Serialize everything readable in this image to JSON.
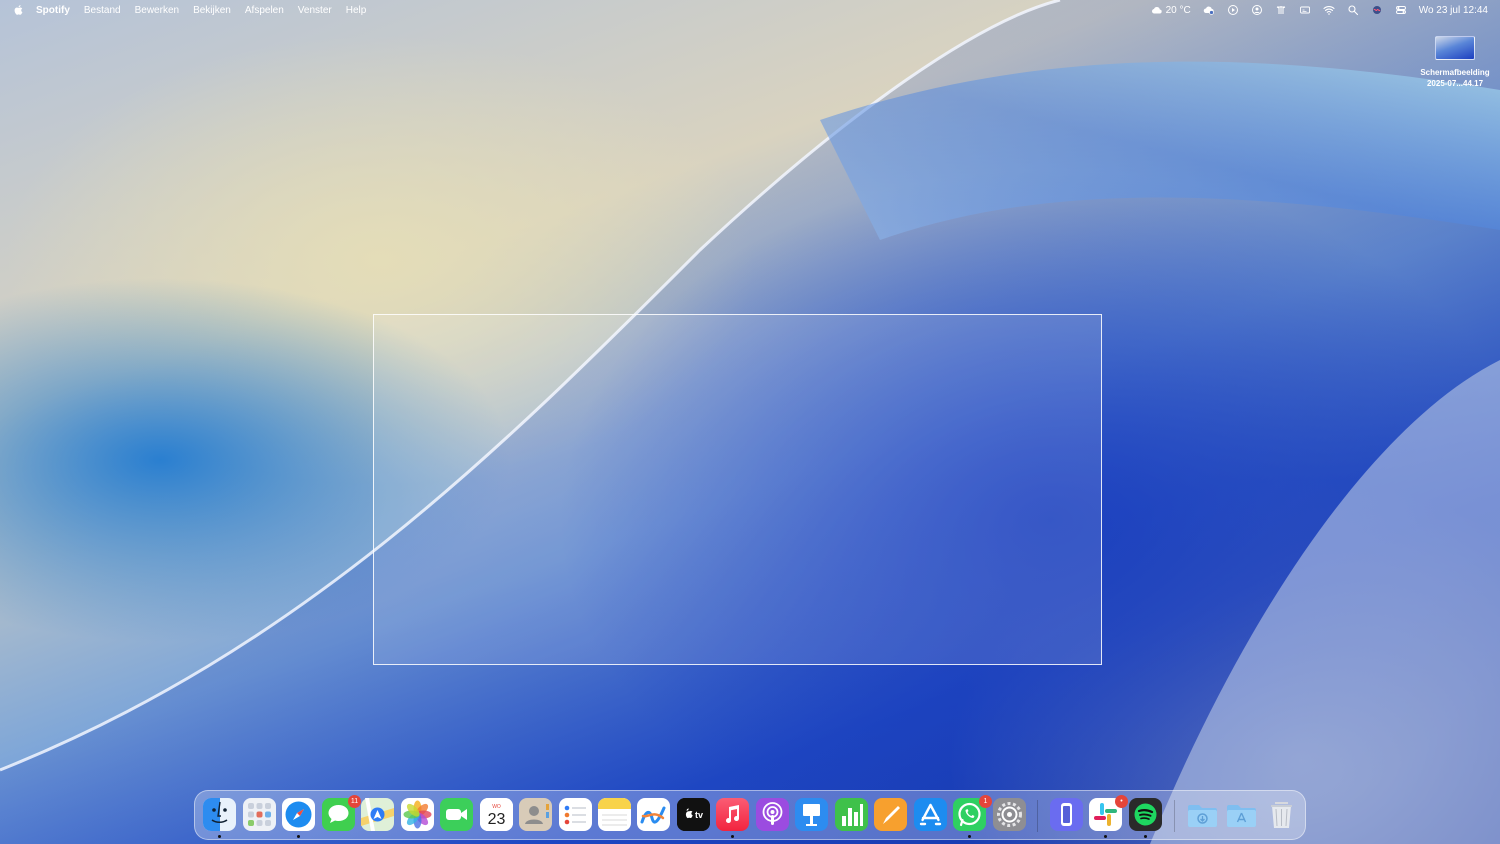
{
  "menubar": {
    "app_name": "Spotify",
    "menus": [
      "Bestand",
      "Bewerken",
      "Bekijken",
      "Afspelen",
      "Venster",
      "Help"
    ],
    "weather": "20 °C",
    "clock": "Wo 23 jul 12:44"
  },
  "desktop": {
    "file": {
      "name_line1": "Schermafbeelding",
      "name_line2": "2025-07...44.17"
    }
  },
  "dock": {
    "apps": [
      {
        "name": "Finder",
        "icon": "finder-icon",
        "running": true
      },
      {
        "name": "Launchpad",
        "icon": "launchpad-icon",
        "running": false
      },
      {
        "name": "Safari",
        "icon": "safari-icon",
        "running": true
      },
      {
        "name": "Berichten",
        "icon": "messages-icon",
        "running": false,
        "badge": "11"
      },
      {
        "name": "Kaarten",
        "icon": "maps-icon",
        "running": false
      },
      {
        "name": "Foto's",
        "icon": "photos-icon",
        "running": false
      },
      {
        "name": "FaceTime",
        "icon": "facetime-icon",
        "running": false
      },
      {
        "name": "Agenda",
        "icon": "calendar-icon",
        "running": false,
        "date_day": "23",
        "date_weekday": "WO"
      },
      {
        "name": "Contacten",
        "icon": "contacts-icon",
        "running": false
      },
      {
        "name": "Herinneringen",
        "icon": "reminders-icon",
        "running": false
      },
      {
        "name": "Notities",
        "icon": "notes-icon",
        "running": false
      },
      {
        "name": "Freeform",
        "icon": "freeform-icon",
        "running": false
      },
      {
        "name": "TV",
        "icon": "tv-icon",
        "running": false,
        "label": "tv"
      },
      {
        "name": "Muziek",
        "icon": "music-icon",
        "running": true
      },
      {
        "name": "Podcasts",
        "icon": "podcasts-icon",
        "running": false
      },
      {
        "name": "Keynote",
        "icon": "keynote-icon",
        "running": false
      },
      {
        "name": "Numbers",
        "icon": "numbers-icon",
        "running": false
      },
      {
        "name": "Pages",
        "icon": "pages-icon",
        "running": false
      },
      {
        "name": "App Store",
        "icon": "app-store-icon",
        "running": false
      },
      {
        "name": "WhatsApp",
        "icon": "whatsapp-icon",
        "running": true,
        "badge": "1"
      },
      {
        "name": "Systeeminstellingen",
        "icon": "settings-icon",
        "running": false
      },
      {
        "name": "iPhone-synchronisatie",
        "icon": "iphone-mirroring-icon",
        "running": false
      },
      {
        "name": "Slack",
        "icon": "slack-icon",
        "running": true,
        "badge": "•"
      },
      {
        "name": "Spotify",
        "icon": "spotify-icon",
        "running": true
      }
    ],
    "folders": [
      {
        "name": "Downloads",
        "icon": "downloads-folder-icon"
      },
      {
        "name": "Programma's",
        "icon": "applications-folder-icon"
      },
      {
        "name": "Prullenmand",
        "icon": "trash-icon"
      }
    ]
  }
}
